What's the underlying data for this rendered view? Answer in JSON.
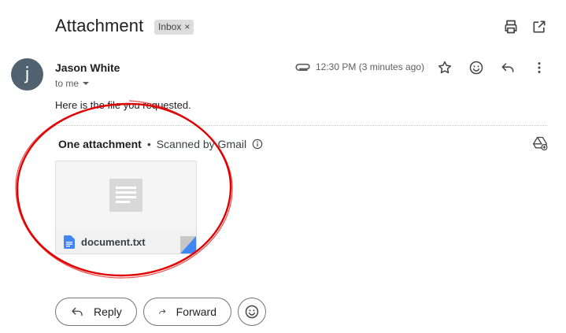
{
  "subject": "Attachment",
  "label": {
    "text": "Inbox",
    "close": "×"
  },
  "sender": {
    "avatar_letter": "j",
    "name": "Jason White",
    "to": "to me",
    "avatar_color": "#50626f"
  },
  "meta": {
    "time": "12:30 PM (3 minutes ago)"
  },
  "icons": {
    "top": [
      "print-icon",
      "open-in-new-window-icon"
    ],
    "message": [
      "attachment-clip-icon",
      "star-icon",
      "emoji-icon",
      "reply-icon",
      "more-vert-icon"
    ],
    "attachments": [
      "add-to-drive-icon",
      "info-icon",
      "doc-file-icon",
      "preview-lines-icon"
    ]
  },
  "body": {
    "text": "Here is the file you requested."
  },
  "attachments": {
    "count_label": "One attachment",
    "separator": "•",
    "scan_label": "Scanned by Gmail",
    "files": [
      {
        "name": "document.txt",
        "icon_color": "#4285f4"
      }
    ]
  },
  "actions": {
    "reply": "Reply",
    "forward": "Forward"
  },
  "annotation": {
    "color": "#e00000",
    "shape": "hand-drawn circle around attachment"
  }
}
